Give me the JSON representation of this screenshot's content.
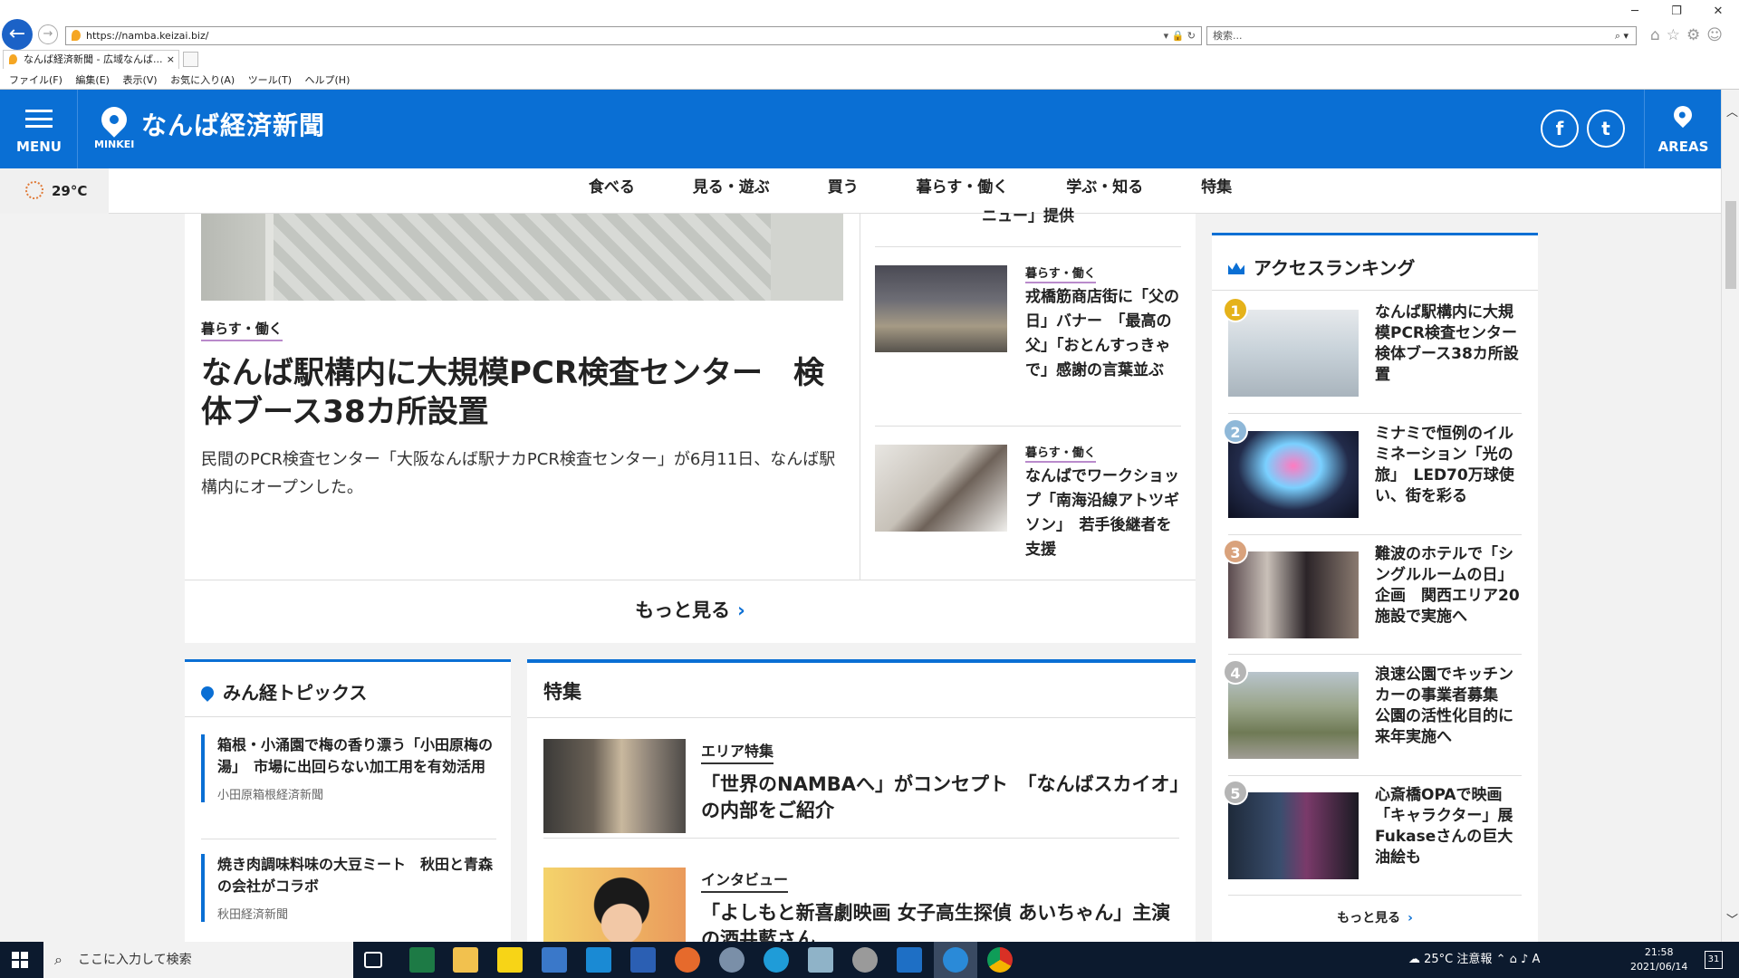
{
  "browser": {
    "url": "https://namba.keizai.biz/",
    "search_placeholder": "検索...",
    "tab_title": "なんば経済新聞 - 広域なんば...",
    "tab_close": "×",
    "menu": [
      "ファイル(F)",
      "編集(E)",
      "表示(V)",
      "お気に入り(A)",
      "ツール(T)",
      "ヘルプ(H)"
    ]
  },
  "header": {
    "menu_label": "MENU",
    "brand_small": "MINKEI",
    "site_title": "なんば経済新聞",
    "facebook": "f",
    "twitter": "t",
    "areas_label": "AREAS",
    "brand_color": "#0a6fd4"
  },
  "weather": {
    "temp": "29°C"
  },
  "categories": [
    "食べる",
    "見る・遊ぶ",
    "買う",
    "暮らす・働く",
    "学ぶ・知る",
    "特集"
  ],
  "lead": {
    "category": "暮らす・働く",
    "title": "なんば駅構内に大規模PCR検査センター　検体ブース38カ所設置",
    "description": "民間のPCR検査センター「大阪なんば駅ナカPCR検査センター」が6月11日、なんば駅構内にオープンした。"
  },
  "side_articles": [
    {
      "category": "",
      "title": "ニュー」提供"
    },
    {
      "category": "暮らす・働く",
      "title": "戎橋筋商店街に「父の日」バナー　「最高の父」「おとんすっきゃで」感謝の言葉並ぶ"
    },
    {
      "category": "暮らす・働く",
      "title": "なんばでワークショップ「南海沿線アトツギソン」　若手後継者を支援"
    }
  ],
  "more_label": "もっと見る",
  "topics": {
    "heading": "みん経トピックス",
    "items": [
      {
        "title": "箱根・小涌園で梅の香り漂う「小田原梅の湯」　市場に出回らない加工用を有効活用",
        "source": "小田原箱根経済新聞"
      },
      {
        "title": "焼き肉調味料味の大豆ミート　秋田と青森の会社がコラボ",
        "source": "秋田経済新聞"
      }
    ]
  },
  "feature": {
    "heading": "特集",
    "items": [
      {
        "category": "エリア特集",
        "title": "「世界のNAMBAへ」がコンセプト　「なんばスカイオ」の内部をご紹介"
      },
      {
        "category": "インタビュー",
        "title": "「よしもと新喜劇映画 女子高生探偵 あいちゃん」主演の酒井藍さん"
      }
    ]
  },
  "ranking": {
    "heading": "アクセスランキング",
    "items": [
      {
        "rank": "1",
        "title": "なんば駅構内に大規模PCR検査センター　検体ブース38カ所設置",
        "color": "#e5b21a"
      },
      {
        "rank": "2",
        "title": "ミナミで恒例のイルミネーション「光の旅」　LED70万球使い、街を彩る",
        "color": "#8fb8d8"
      },
      {
        "rank": "3",
        "title": "難波のホテルで「シングルルームの日」企画　関西エリア20施設で実施へ",
        "color": "#d9a27c"
      },
      {
        "rank": "4",
        "title": "浪速公園でキッチンカーの事業者募集　公園の活性化目的に来年実施へ",
        "color": "#b5b5b5"
      },
      {
        "rank": "5",
        "title": "心斎橋OPAで映画「キャラクター」展　Fukaseさんの巨大油絵も",
        "color": "#b5b5b5"
      }
    ],
    "more": "もっと見る"
  },
  "taskbar": {
    "search_placeholder": "ここに入力して検索",
    "weather": "25°C",
    "weather_status": "注意報",
    "ime": "A",
    "time": "21:58",
    "date": "2021/06/14",
    "notifications": "31"
  }
}
